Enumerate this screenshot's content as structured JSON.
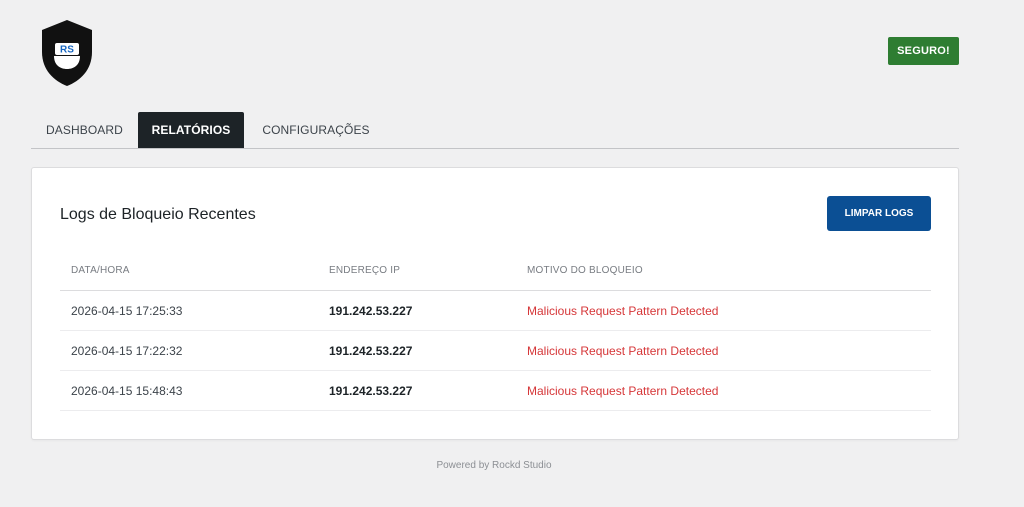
{
  "brand": {
    "logo_text": "RS"
  },
  "status_badge": "SEGURO!",
  "tabs": [
    {
      "label": "DASHBOARD",
      "active": false
    },
    {
      "label": "RELATÓRIOS",
      "active": true
    },
    {
      "label": "CONFIGURAÇÕES",
      "active": false
    }
  ],
  "logs": {
    "title": "Logs de Bloqueio Recentes",
    "clear_button": "LIMPAR LOGS",
    "columns": [
      "DATA/HORA",
      "ENDEREÇO IP",
      "MOTIVO DO BLOQUEIO"
    ],
    "rows": [
      {
        "datetime": "2026-04-15 17:25:33",
        "ip": "191.242.53.227",
        "reason": "Malicious Request Pattern Detected"
      },
      {
        "datetime": "2026-04-15 17:22:32",
        "ip": "191.242.53.227",
        "reason": "Malicious Request Pattern Detected"
      },
      {
        "datetime": "2026-04-15 15:48:43",
        "ip": "191.242.53.227",
        "reason": "Malicious Request Pattern Detected"
      }
    ]
  },
  "footer": "Powered by Rockd Studio",
  "colors": {
    "badge_green": "#2e7d32",
    "button_blue": "#0b4f94",
    "active_tab": "#1d2327",
    "reason_red": "#d63638"
  }
}
